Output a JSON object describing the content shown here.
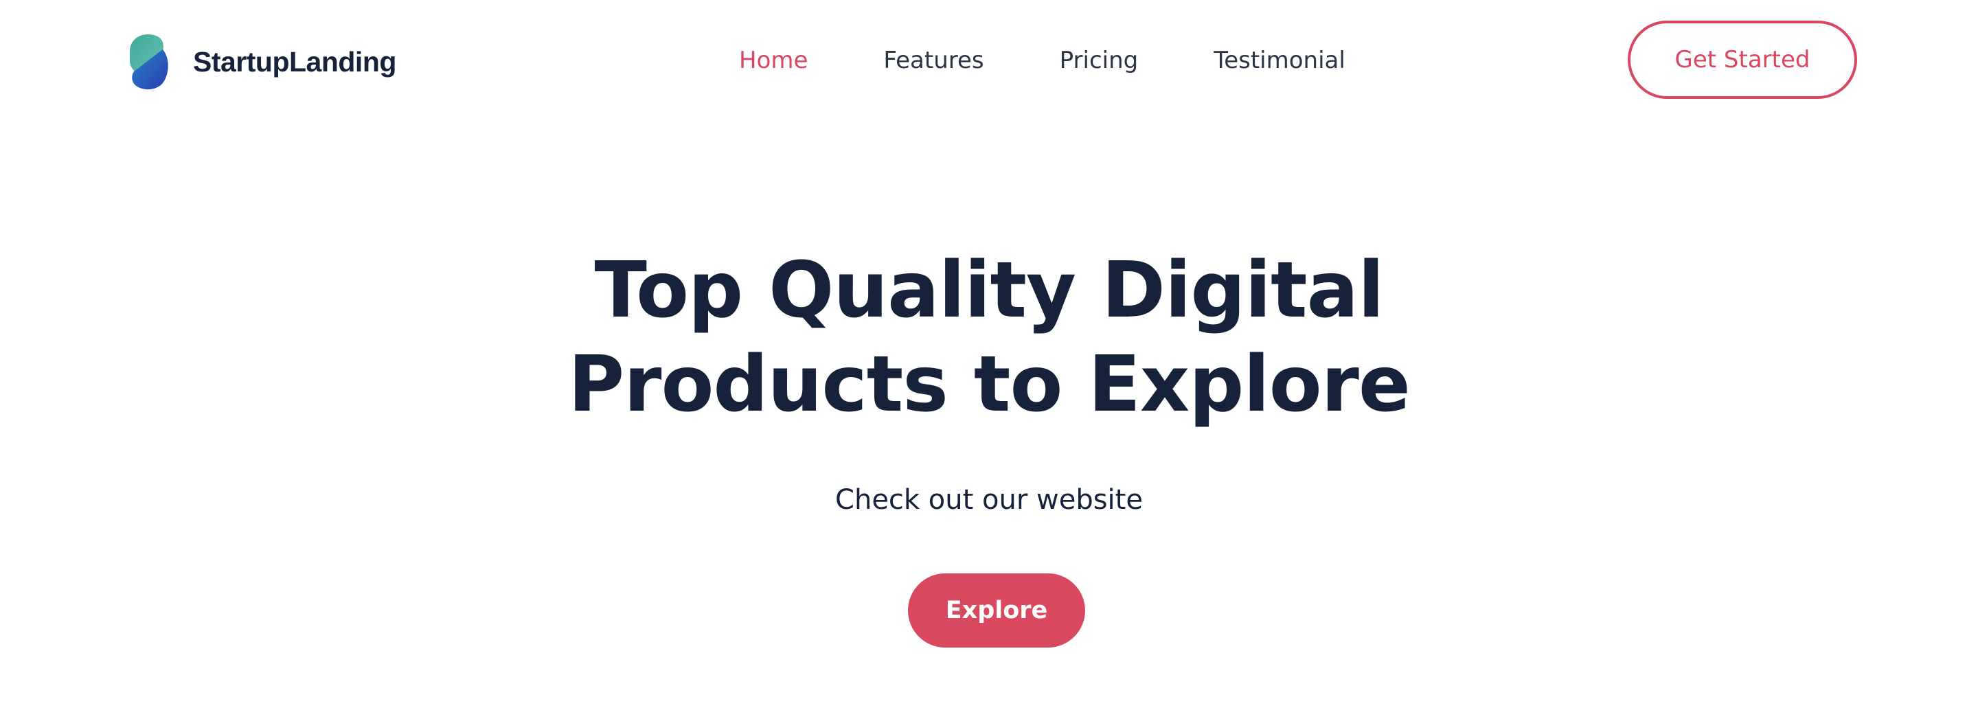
{
  "header": {
    "brand": "StartupLanding",
    "logo_icon": "startup-logo-icon",
    "nav": [
      {
        "label": "Home",
        "active": true
      },
      {
        "label": "Features",
        "active": false
      },
      {
        "label": "Pricing",
        "active": false
      },
      {
        "label": "Testimonial",
        "active": false
      }
    ],
    "cta_label": "Get Started"
  },
  "hero": {
    "title_line1": "Top Quality Digital",
    "title_line2": "Products to Explore",
    "subtitle": "Check out our website",
    "button_label": "Explore"
  },
  "colors": {
    "accent": "#d8475f",
    "heading": "#16213a",
    "nav_text": "#2b3445",
    "logo_teal": "#4fb3a1",
    "logo_blue": "#2b56c4"
  }
}
